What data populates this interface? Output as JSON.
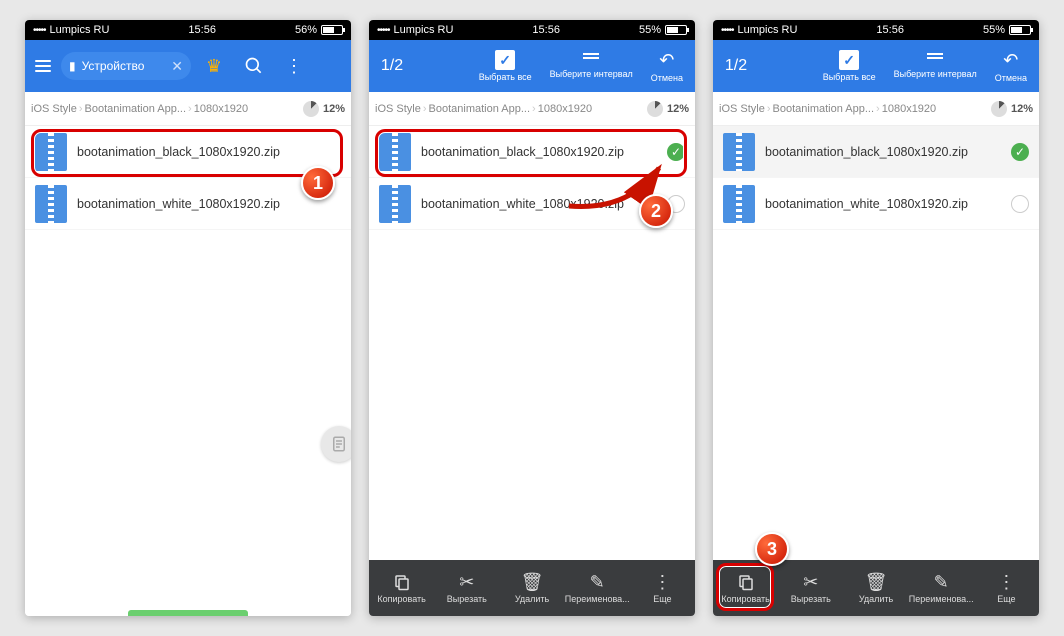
{
  "status": {
    "carrier": "Lumpics RU",
    "time": "15:56",
    "battery1": "56%",
    "battery2": "55%",
    "battery3": "55%"
  },
  "toolbar1": {
    "chip": "Устройство"
  },
  "toolbar_sel": {
    "count": "1/2",
    "select_all": "Выбрать все",
    "select_range": "Выберите интервал",
    "cancel": "Отмена"
  },
  "breadcrumb": {
    "c1": "iOS Style",
    "c2": "Bootanimation App...",
    "c3": "1080x1920",
    "storage": "12%"
  },
  "files": {
    "f1": "bootanimation_black_1080x1920.zip",
    "f2": "bootanimation_white_1080x1920.zip"
  },
  "bottom": {
    "copy": "Копировать",
    "cut": "Вырезать",
    "del": "Удалить",
    "ren": "Переименова...",
    "more": "Еще"
  },
  "badges": {
    "b1": "1",
    "b2": "2",
    "b3": "3"
  }
}
